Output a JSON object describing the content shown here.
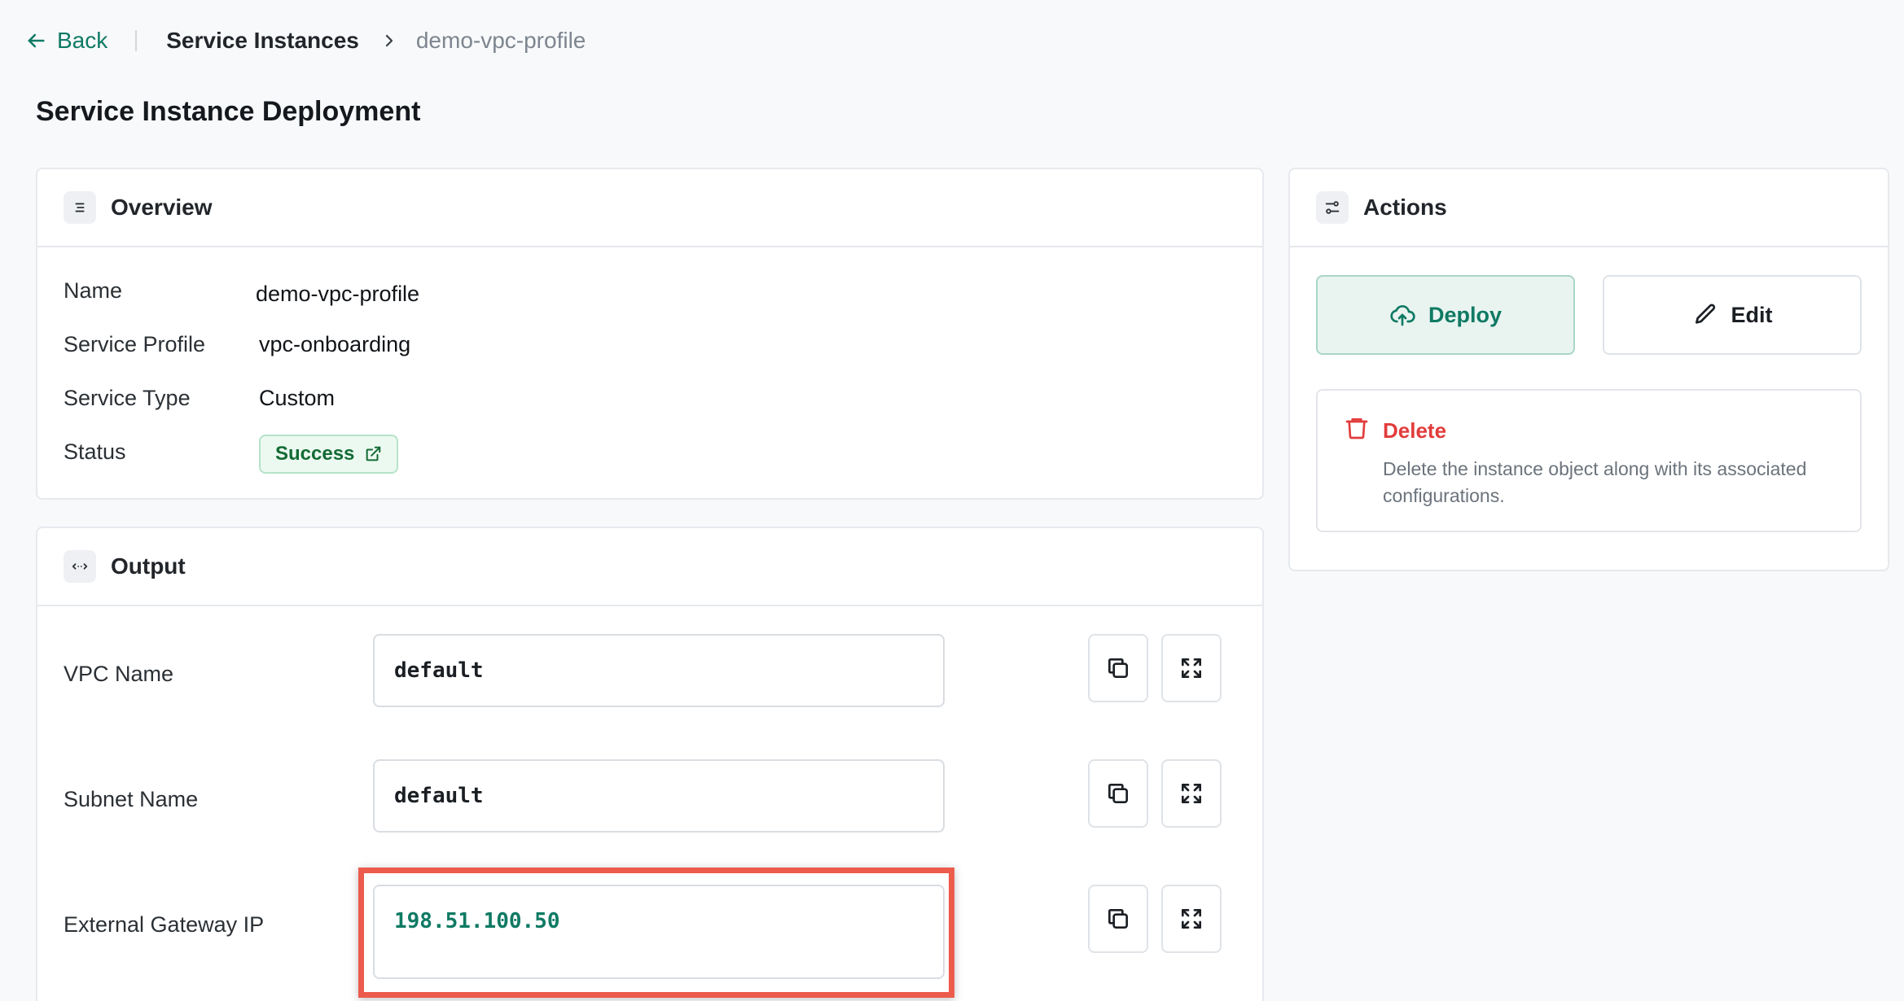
{
  "breadcrumb": {
    "back_label": "Back",
    "section": "Service Instances",
    "current": "demo-vpc-profile"
  },
  "page_title": "Service Instance Deployment",
  "overview": {
    "title": "Overview",
    "fields": [
      {
        "label": "Name",
        "value": "demo-vpc-profile"
      },
      {
        "label": "Service Profile",
        "value": "vpc-onboarding"
      },
      {
        "label": "Service Type",
        "value": "Custom"
      },
      {
        "label": "Status",
        "value": "Success"
      }
    ]
  },
  "output": {
    "title": "Output",
    "rows": [
      {
        "label": "VPC Name",
        "value": "default"
      },
      {
        "label": "Subnet Name",
        "value": "default"
      },
      {
        "label": "External Gateway IP",
        "value": "198.51.100.50"
      }
    ]
  },
  "actions": {
    "title": "Actions",
    "deploy_label": "Deploy",
    "edit_label": "Edit",
    "delete_title": "Delete",
    "delete_desc": "Delete the instance object along with its associated configurations."
  },
  "colors": {
    "accent": "#0f7a64",
    "danger": "#e23c3c",
    "success": "#136b34",
    "highlight_frame": "#ec5b4c"
  },
  "icons": [
    "arrow-left-icon",
    "chevron-right-icon",
    "list-icon",
    "code-icon",
    "sliders-icon",
    "external-link-icon",
    "copy-icon",
    "expand-icon",
    "cloud-upload-icon",
    "pencil-icon",
    "trash-icon"
  ]
}
